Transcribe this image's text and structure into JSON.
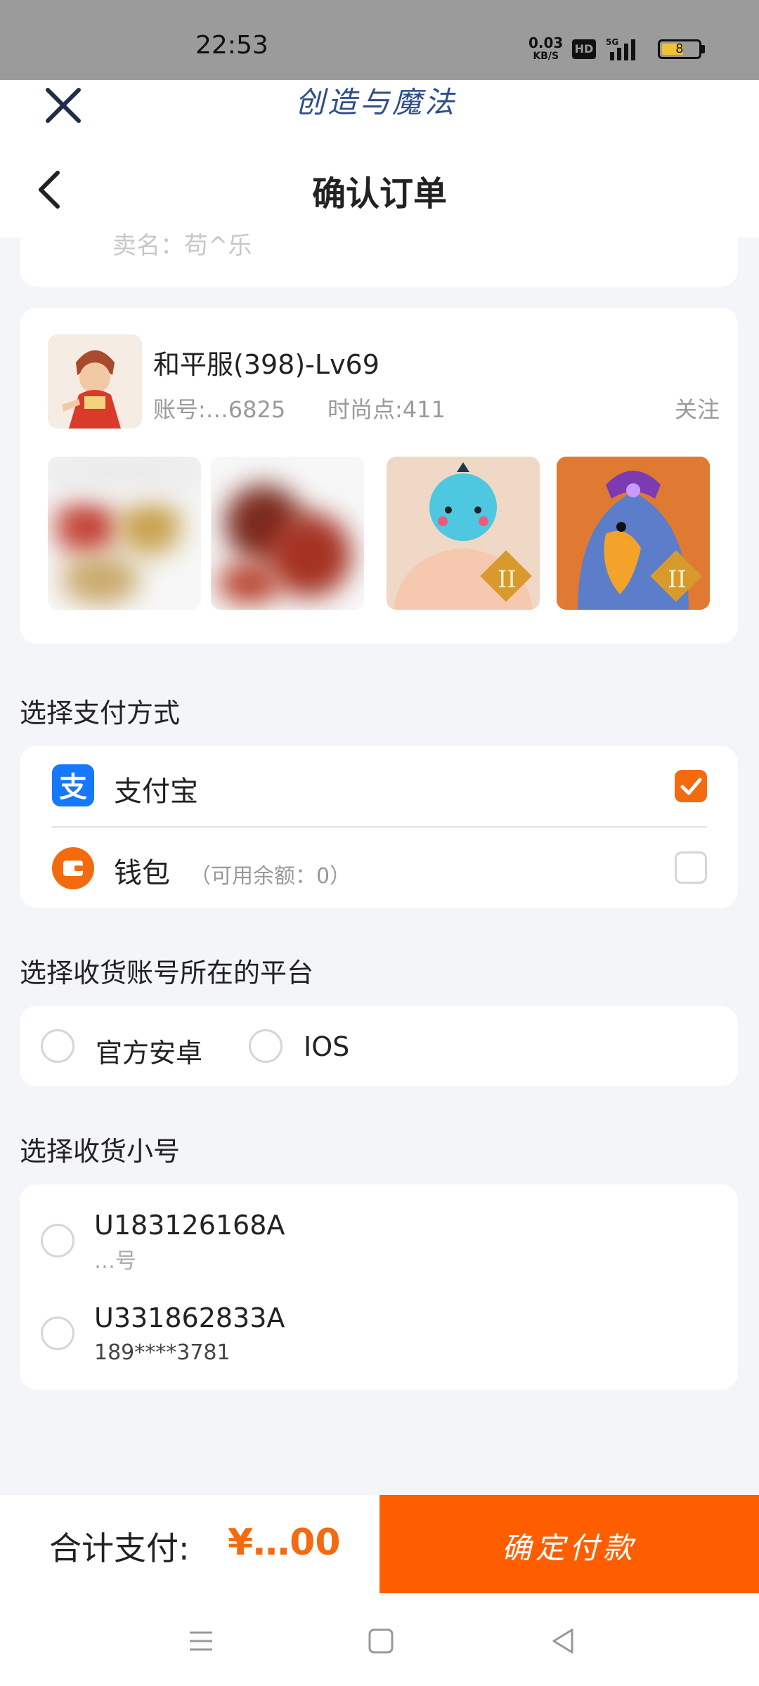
{
  "status_bar": {
    "time": "22:53",
    "net_speed_value": "0.03",
    "net_speed_unit": "KB/S",
    "hd_label": "HD",
    "network_label": "5G",
    "battery_level": "8"
  },
  "header": {
    "brand": "创造与魔法",
    "title": "确认订单"
  },
  "seller": {
    "label": "卖名：苟^乐"
  },
  "product": {
    "title": "和平服(398)-Lv69",
    "id_text": "账号:…6825",
    "fashion_points": "时尚点:411",
    "follow_label": "关注"
  },
  "payment": {
    "section_title": "选择支付方式",
    "options": [
      {
        "label": "支付宝",
        "sub": "",
        "selected": true
      },
      {
        "label": "钱包",
        "sub": "（可用余额：0）",
        "selected": false
      }
    ]
  },
  "platform": {
    "section_title": "选择收货账号所在的平台",
    "options": [
      {
        "label": "官方安卓",
        "selected": false
      },
      {
        "label": "IOS",
        "selected": false
      }
    ]
  },
  "accounts": {
    "section_title": "选择收货小号",
    "items": [
      {
        "id": "U183126168A",
        "sub": "…号"
      },
      {
        "id": "U331862833A",
        "sub": "189****3781"
      }
    ]
  },
  "footer": {
    "total_label": "合计支付:",
    "total_value": "¥…00",
    "pay_button": "确定付款"
  },
  "colors": {
    "accent": "#ff5e00",
    "alipay_blue": "#1677ff",
    "wallet_orange": "#f46a0e"
  }
}
